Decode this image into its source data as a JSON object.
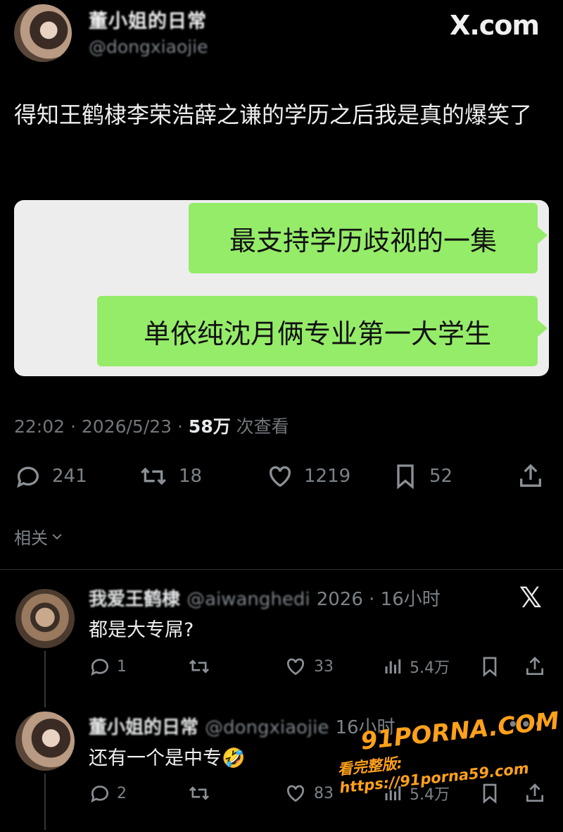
{
  "header": {
    "author_name": "董小姐的日常",
    "author_handle": "@dongxiaojie",
    "logo": "X.com"
  },
  "tweet": {
    "text": "得知王鹤棣李荣浩薛之谦的学历之后我是真的爆笑了",
    "image_bubbles": [
      "最支持学历歧视的一集",
      "单依纯沈月俩专业第一大学生"
    ],
    "time": "22:02 · 2026/5/23 · ",
    "views_count": "58万",
    "views_label": " 次查看",
    "replies": "241",
    "retweets": "18",
    "likes": "1219",
    "bookmarks": "52"
  },
  "related_label": "相关",
  "replies": [
    {
      "name": "我爱王鹤棣",
      "handle": "@aiwanghedi",
      "time": "2026 · 16小时",
      "text": "都是大专屌?",
      "replies": "1",
      "likes": "33",
      "views": "5.4万"
    },
    {
      "name": "董小姐的日常",
      "handle": "@dongxiaojie",
      "time": "16小时",
      "text": "还有一个是中专🤣",
      "replies": "2",
      "likes": "83",
      "views": "5.4万"
    }
  ],
  "watermark": {
    "brand": "91PORNA.COM",
    "url": "看完整版: https://91porna59.com"
  }
}
